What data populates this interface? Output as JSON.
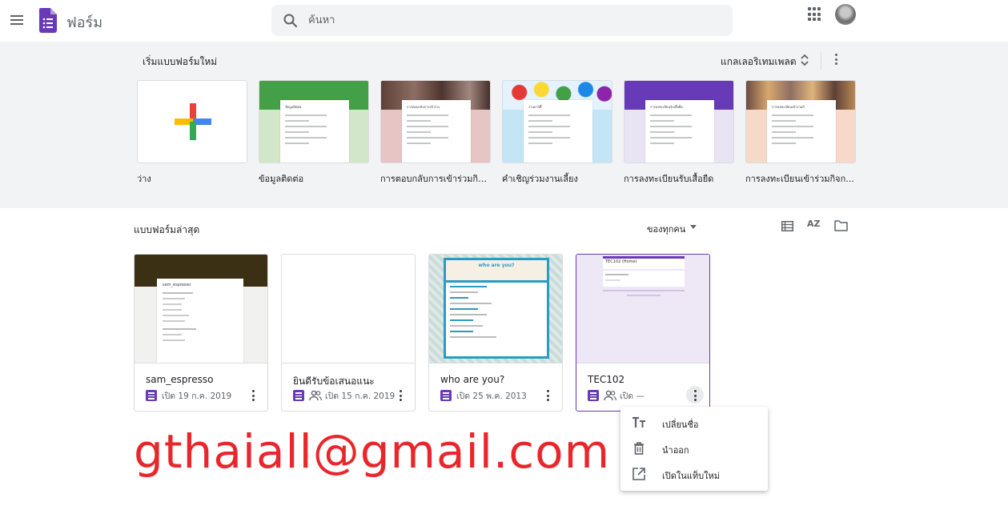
{
  "header": {
    "app_title": "ฟอร์ม",
    "search_placeholder": "ค้นหา"
  },
  "gallery": {
    "title": "เริ่มแบบฟอร์มใหม่",
    "template_gallery_label": "แกลเลอริเทมเพลต",
    "templates": [
      {
        "label": "ว่าง",
        "color": "#ffffff"
      },
      {
        "label": "ข้อมูลติดต่อ",
        "color": "#d2e7c9"
      },
      {
        "label": "การตอบกลับการเข้าร่วมกิจ...",
        "color": "#e6c5c4"
      },
      {
        "label": "คำเชิญร่วมงานเลี้ยง",
        "color": "#c3e5f6"
      },
      {
        "label": "การลงทะเบียนรับเสื้อยืด",
        "color": "#e9e4f3"
      },
      {
        "label": "การลงทะเบียนเข้าร่วมกิจก...",
        "color": "#f6d9c9"
      }
    ],
    "mini_titles": [
      "ข้อมูลติดต่อ",
      "การตอบกลับการเข้าร่วมกิจกรรม",
      "งานปาร์ตี้",
      "การลงทะเบียนรับเสื้อยืด",
      "การลงทะเบียนเข้าร่วมกิจกรรม"
    ]
  },
  "recent": {
    "title": "แบบฟอร์มล่าสุด",
    "owner_filter": "ของทุกคน",
    "sort_icon_text": "AZ",
    "cards": [
      {
        "title": "sam_espresso",
        "meta": "เปิด 19 ก.ค. 2019",
        "shared": false,
        "thumb_title": "sam_espresso"
      },
      {
        "title": "ยินดีรับข้อเสนอแนะ",
        "meta": "เปิด 15 ก.ค. 2019",
        "shared": true
      },
      {
        "title": "who are you?",
        "meta": "เปิด 25 พ.ค. 2013",
        "shared": false,
        "thumb_title": "who are you?"
      },
      {
        "title": "TEC102",
        "meta": "เปิด —",
        "shared": true,
        "thumb_title": "TEC102 (Home)"
      }
    ]
  },
  "context_menu": {
    "items": [
      {
        "label": "เปลี่ยนชื่อ",
        "icon": "text-rename-icon"
      },
      {
        "label": "นำออก",
        "icon": "trash-icon"
      },
      {
        "label": "เปิดในแท็บใหม่",
        "icon": "open-in-new-icon"
      }
    ]
  },
  "watermark": "gthaiall@gmail.com",
  "colors": {
    "brand": "#673ab7",
    "gallery_bg": "#f1f3f4",
    "watermark": "#e8262b"
  }
}
